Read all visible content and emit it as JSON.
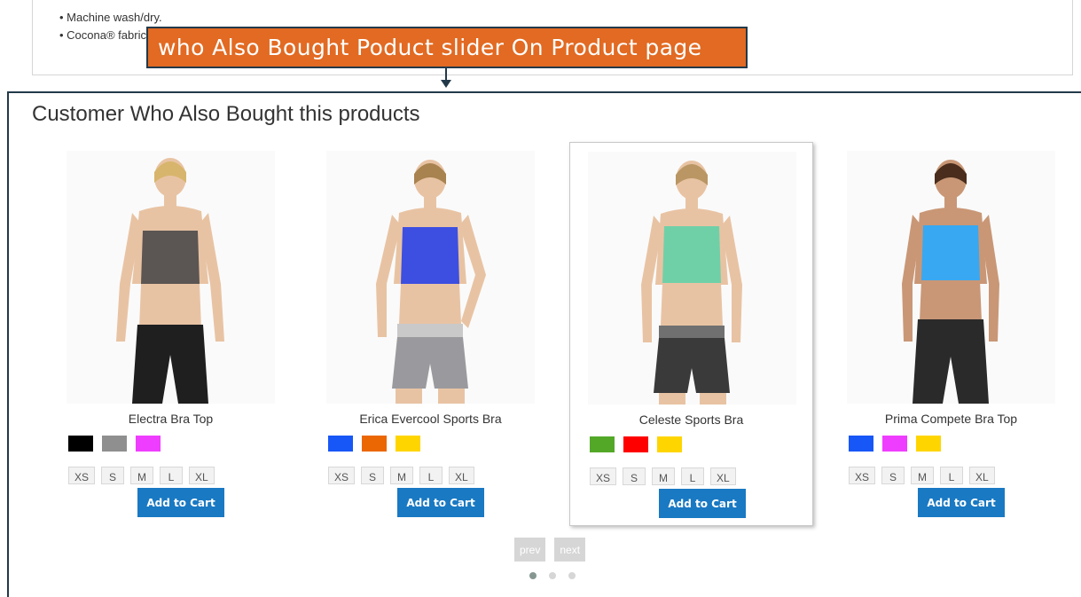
{
  "description": {
    "bullets": [
      "Machine wash/dry.",
      "Cocona® fabric for superior breathability."
    ]
  },
  "callout": {
    "text": "who Also Bought Poduct slider On Product page"
  },
  "section": {
    "title": "Customer Who Also Bought this products"
  },
  "products": [
    {
      "name": "Electra Bra Top",
      "top_color": "#5b5553",
      "bottom_color": "#1f1f1f",
      "swatches": [
        "#000000",
        "#8f8f8f",
        "#ef3dff"
      ],
      "sizes": [
        "XS",
        "S",
        "M",
        "L",
        "XL"
      ],
      "add_to_cart_label": "Add to Cart"
    },
    {
      "name": "Erica Evercool Sports Bra",
      "top_color": "#3d4fe0",
      "bottom_color": "#9a9a9e",
      "swatches": [
        "#1857f7",
        "#eb6703",
        "#ffd500"
      ],
      "sizes": [
        "XS",
        "S",
        "M",
        "L",
        "XL"
      ],
      "add_to_cart_label": "Add to Cart"
    },
    {
      "name": "Celeste Sports Bra",
      "top_color": "#6fd0a8",
      "bottom_color": "#3a3a3a",
      "swatches": [
        "#53a828",
        "#ff0000",
        "#ffd500"
      ],
      "sizes": [
        "XS",
        "S",
        "M",
        "L",
        "XL"
      ],
      "add_to_cart_label": "Add to Cart"
    },
    {
      "name": "Prima Compete Bra Top",
      "top_color": "#38a8f2",
      "bottom_color": "#2a2a2a",
      "swatches": [
        "#1857f7",
        "#ef3dff",
        "#ffd500"
      ],
      "sizes": [
        "XS",
        "S",
        "M",
        "L",
        "XL"
      ],
      "add_to_cart_label": "Add to Cart"
    }
  ],
  "pager": {
    "prev_label": "prev",
    "next_label": "next",
    "pages": 3,
    "active_page": 1
  },
  "colors": {
    "callout_bg": "#e26a22",
    "frame": "#22394a",
    "button": "#1979c3"
  }
}
